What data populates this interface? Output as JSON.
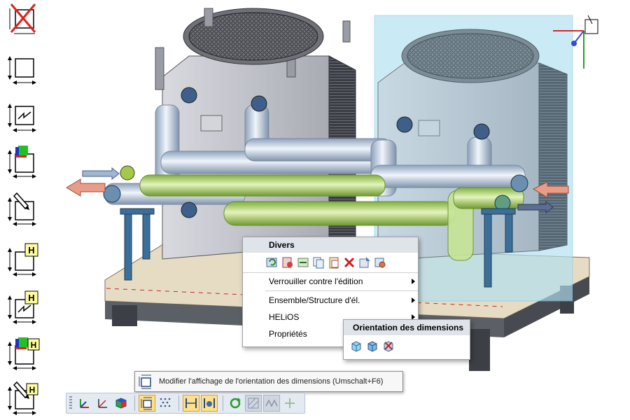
{
  "context_menu": {
    "header": "Divers",
    "icon_names": [
      "refresh-icon",
      "configure-icon",
      "dimension-icon",
      "copy-icon",
      "paste-icon",
      "delete-icon",
      "export-icon",
      "settings-icon"
    ],
    "items": [
      {
        "label": "Verrouiller contre l'édition",
        "submenu": true
      },
      {
        "label": "Ensemble/Structure d'él.",
        "submenu": true
      },
      {
        "label": "HELiOS",
        "submenu": true
      },
      {
        "label": "Propriétés",
        "submenu": false
      }
    ]
  },
  "submenu": {
    "header": "Orientation des dimensions",
    "icon_names": [
      "orientation-cube-icon",
      "orientation-cube-alt-icon",
      "orientation-reset-icon"
    ]
  },
  "tooltip": {
    "text": "Modifier l'affichage de l'orientation des dimensions (Umschalt+F6)"
  },
  "left_icons": {
    "badge_letter": "H"
  },
  "colors": {
    "menu_header_bg": "#dfe4ea",
    "toolbar_bg": "#e4eaf2",
    "active_button": "#ffe08a",
    "selection_tint": "#9fd8ee",
    "frame_blue": "#3b6f9a",
    "pipe_green": "#b8dc6e"
  }
}
